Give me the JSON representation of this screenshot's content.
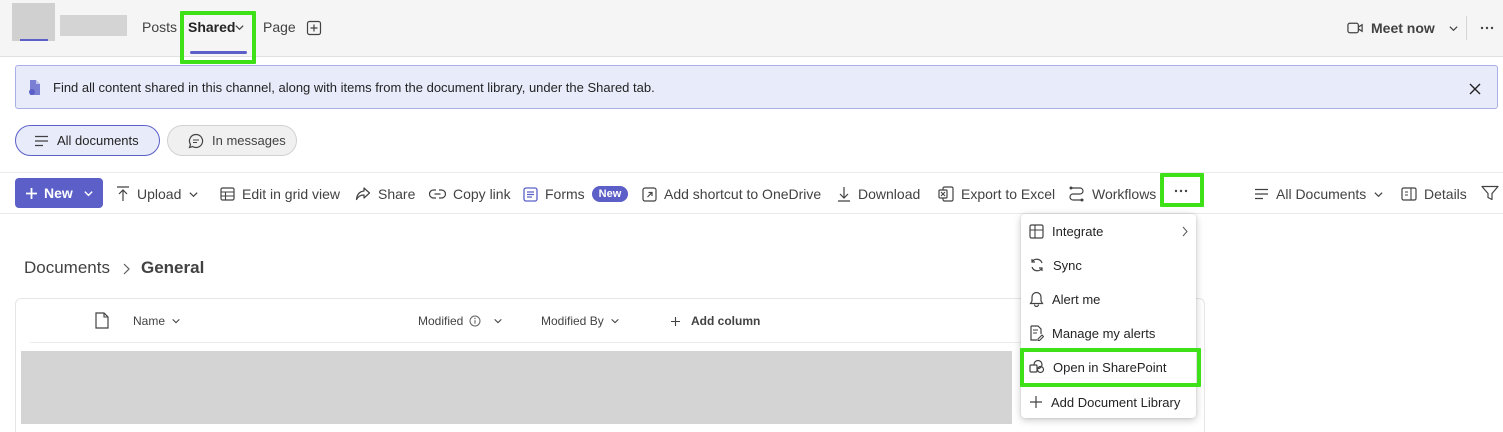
{
  "header": {
    "tabs": [
      "Posts",
      "Shared",
      "Page"
    ],
    "meet_label": "Meet now"
  },
  "banner": {
    "message": "Find all content shared in this channel, along with items from the document library, under the Shared tab."
  },
  "filters": {
    "all_documents": "All documents",
    "in_messages": "In messages"
  },
  "toolbar": {
    "new_label": "New",
    "upload_label": "Upload",
    "edit_grid_label": "Edit in grid view",
    "share_label": "Share",
    "copy_link_label": "Copy link",
    "forms_label": "Forms",
    "forms_badge": "New",
    "shortcut_label": "Add shortcut to OneDrive",
    "download_label": "Download",
    "export_label": "Export to Excel",
    "workflows_label": "Workflows",
    "view_label": "All Documents",
    "details_label": "Details"
  },
  "breadcrumb": {
    "root": "Documents",
    "current": "General"
  },
  "columns": {
    "name": "Name",
    "modified": "Modified",
    "modified_by": "Modified By",
    "add_column": "Add column"
  },
  "overflow_menu": {
    "items": [
      "Integrate",
      "Sync",
      "Alert me",
      "Manage my alerts",
      "Open in SharePoint",
      "Add Document Library"
    ]
  },
  "colors": {
    "accent": "#5b5fc7",
    "highlight": "#3ee018",
    "banner_bg": "#e8ebfa"
  }
}
